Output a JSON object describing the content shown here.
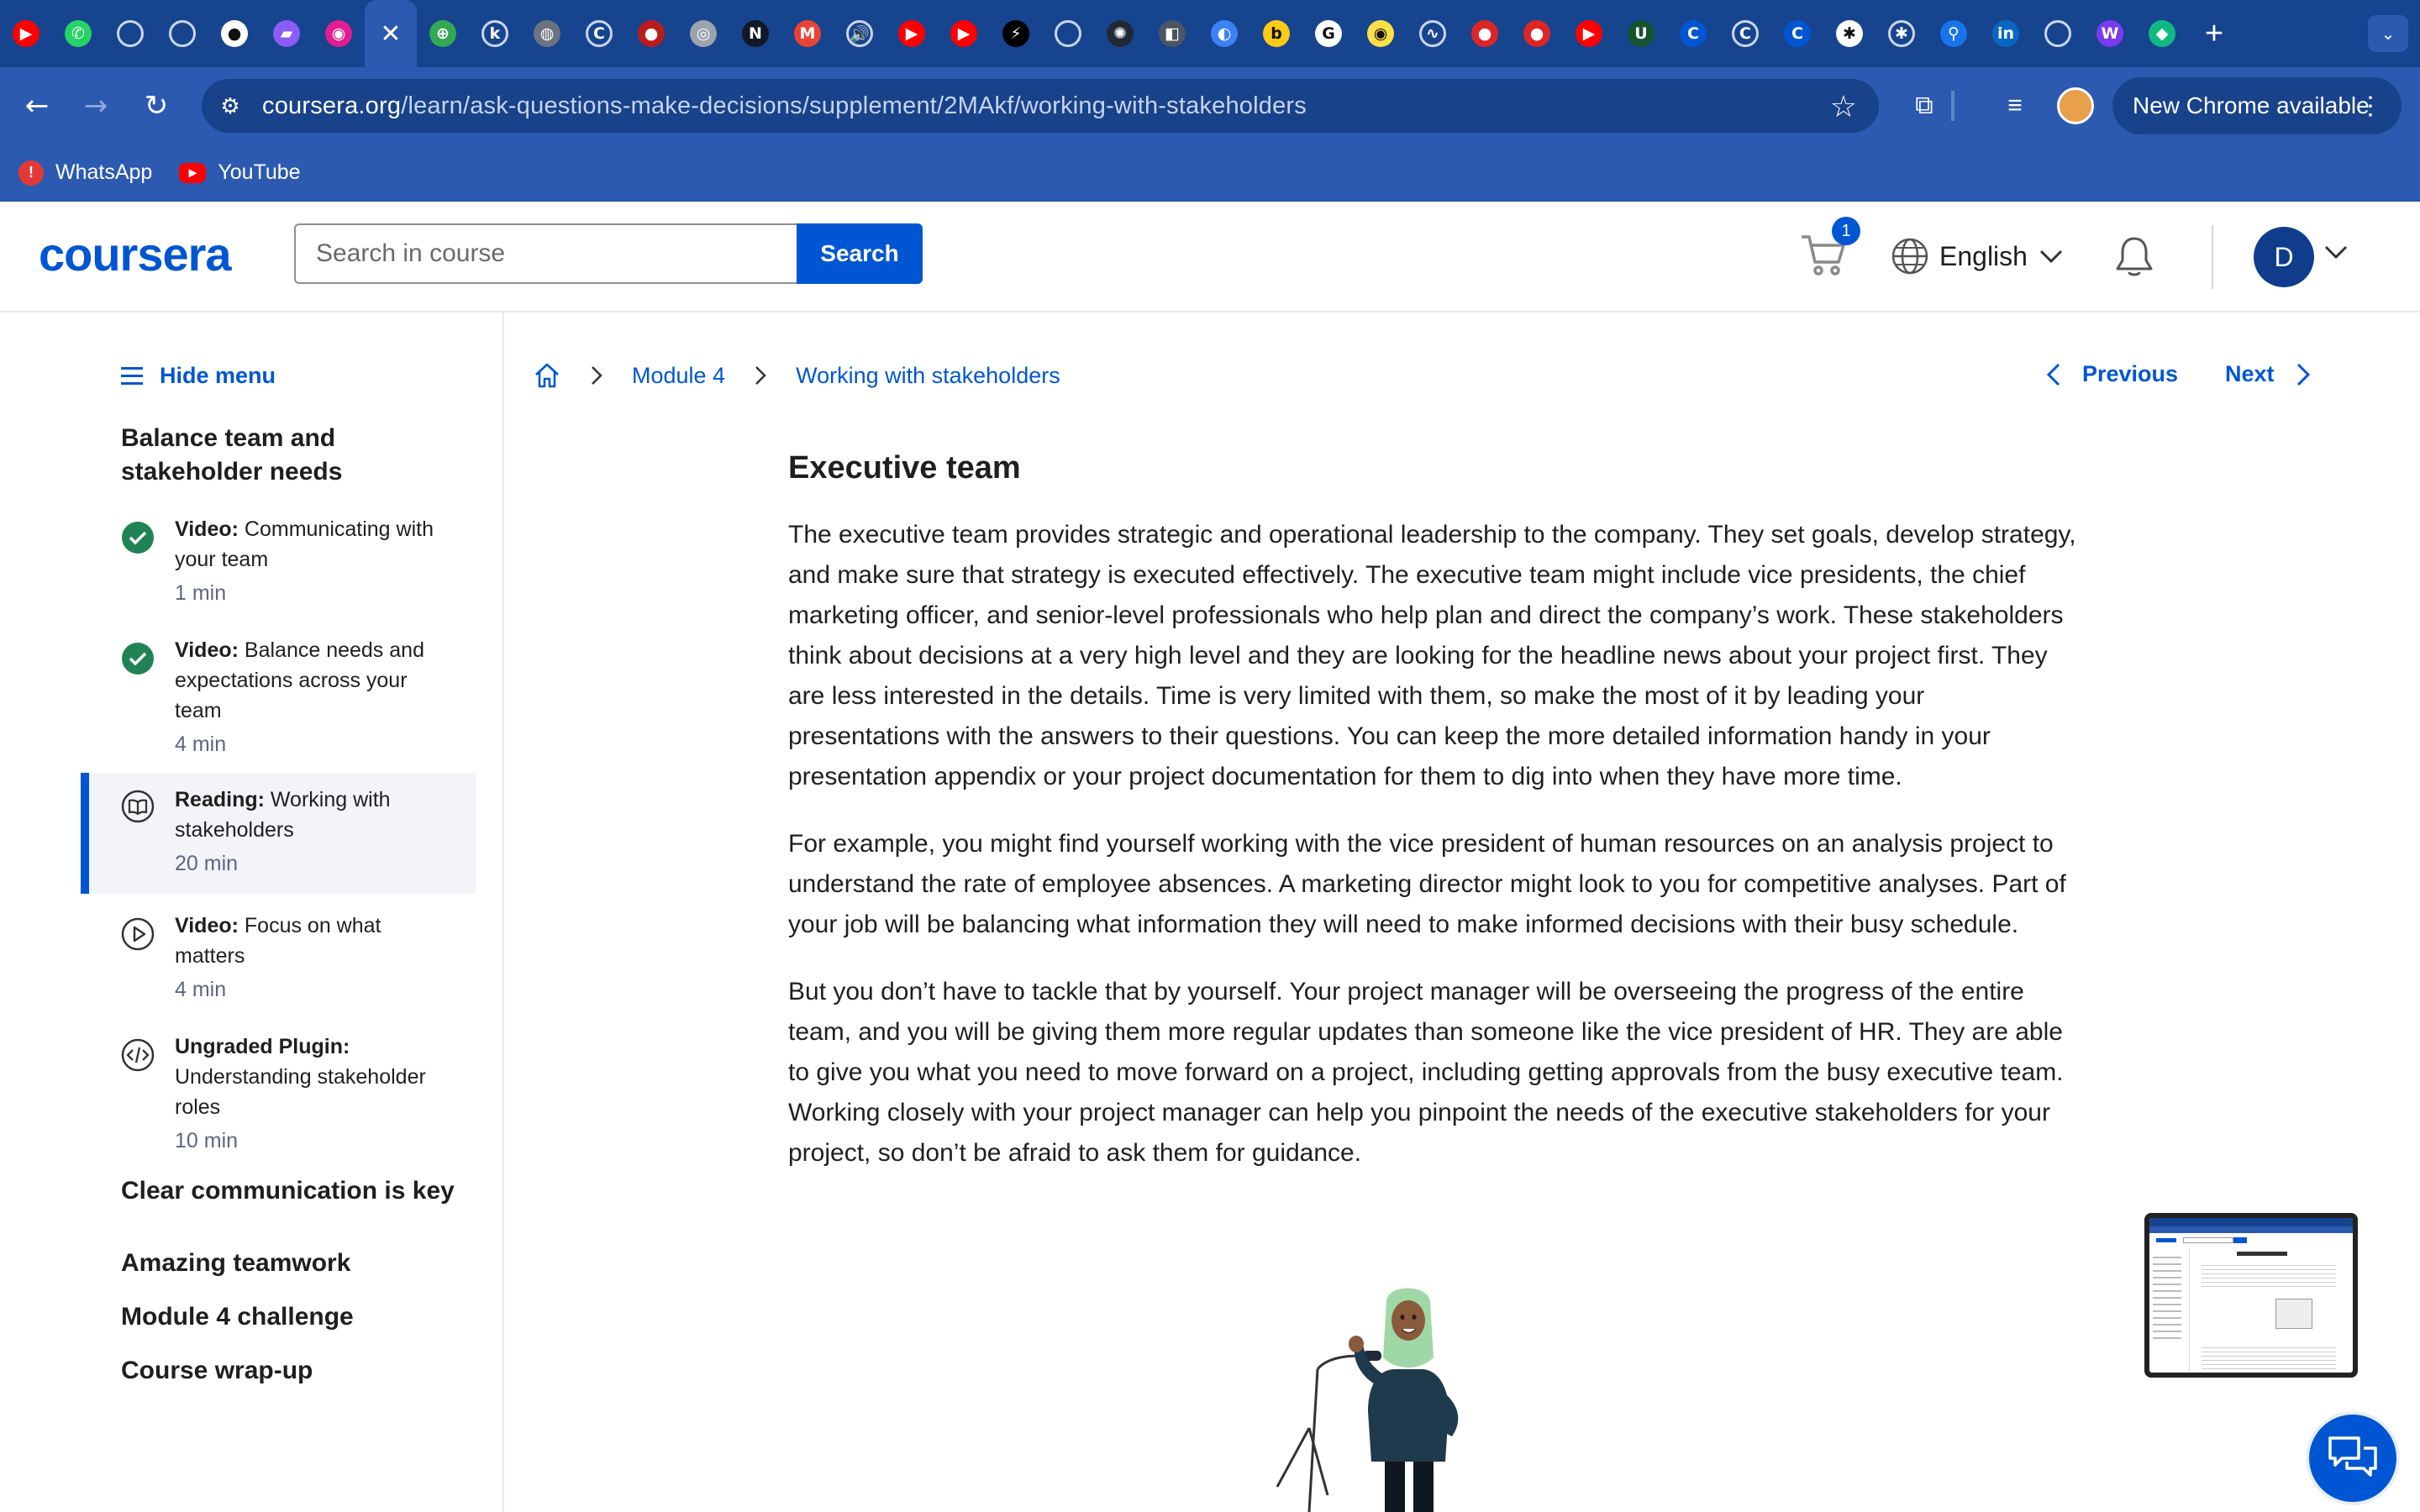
{
  "browser": {
    "tabs": [
      {
        "icon": "youtube-icon",
        "color": "#ff0000",
        "glyph": "▶"
      },
      {
        "icon": "whatsapp-icon",
        "color": "#25d366",
        "glyph": "✆"
      },
      {
        "icon": "loading-icon",
        "color": "",
        "glyph": ""
      },
      {
        "icon": "loading-icon",
        "color": "",
        "glyph": ""
      },
      {
        "icon": "github-icon",
        "color": "#ffffff",
        "glyph": "●"
      },
      {
        "icon": "app-icon",
        "color": "#8b5cf6",
        "glyph": "▰"
      },
      {
        "icon": "app-icon",
        "color": "#e11d8f",
        "glyph": "◉"
      },
      {
        "icon": "close-tab-icon",
        "active": true,
        "glyph": "✕"
      },
      {
        "icon": "app-icon",
        "color": "#34a853",
        "glyph": "⊕"
      },
      {
        "icon": "app-icon",
        "color": "",
        "glyph": "k"
      },
      {
        "icon": "globe-icon",
        "color": "#6b7280",
        "glyph": "◍"
      },
      {
        "icon": "coursera-icon",
        "color": "",
        "glyph": "C"
      },
      {
        "icon": "record-icon",
        "color": "#b91c1c",
        "glyph": "●"
      },
      {
        "icon": "app-icon",
        "color": "#9ca3af",
        "glyph": "◎"
      },
      {
        "icon": "app-icon",
        "color": "#111827",
        "glyph": "N"
      },
      {
        "icon": "gmail-icon",
        "color": "#ea4335",
        "glyph": "M"
      },
      {
        "icon": "speaker-icon",
        "color": "",
        "glyph": "🔊"
      },
      {
        "icon": "youtube-icon",
        "color": "#ff0000",
        "glyph": "▶"
      },
      {
        "icon": "youtube-icon",
        "color": "#ff0000",
        "glyph": "▶"
      },
      {
        "icon": "app-icon",
        "color": "#000000",
        "glyph": "⚡"
      },
      {
        "icon": "loading-icon",
        "color": "",
        "glyph": ""
      },
      {
        "icon": "app-icon",
        "color": "#1f2937",
        "glyph": "✺"
      },
      {
        "icon": "zoom-icon",
        "color": "#4b5563",
        "glyph": "◧"
      },
      {
        "icon": "app-icon",
        "color": "#3b82f6",
        "glyph": "◐"
      },
      {
        "icon": "app-icon",
        "color": "#facc15",
        "glyph": "b"
      },
      {
        "icon": "google-icon",
        "color": "#ffffff",
        "glyph": "G"
      },
      {
        "icon": "app-icon",
        "color": "#fde047",
        "glyph": "◉"
      },
      {
        "icon": "app-icon",
        "color": "",
        "glyph": "∿"
      },
      {
        "icon": "app-icon",
        "color": "#dc2626",
        "glyph": "●"
      },
      {
        "icon": "app-icon",
        "color": "#dc2626",
        "glyph": "●"
      },
      {
        "icon": "youtube-icon",
        "color": "#ff0000",
        "glyph": "▶"
      },
      {
        "icon": "app-icon",
        "color": "#14532d",
        "glyph": "U"
      },
      {
        "icon": "coursera-icon",
        "color": "#0056d2",
        "glyph": "C"
      },
      {
        "icon": "coursera-icon",
        "color": "",
        "glyph": "C"
      },
      {
        "icon": "coursera-icon",
        "color": "#0056d2",
        "glyph": "C"
      },
      {
        "icon": "openai-icon",
        "color": "#ffffff",
        "glyph": "✱"
      },
      {
        "icon": "openai-icon",
        "color": "",
        "glyph": "✱"
      },
      {
        "icon": "maps-icon",
        "color": "#1a73e8",
        "glyph": "⚲"
      },
      {
        "icon": "linkedin-icon",
        "color": "#0a66c2",
        "glyph": "in"
      },
      {
        "icon": "loading-icon",
        "color": "",
        "glyph": ""
      },
      {
        "icon": "app-icon",
        "color": "#7c3aed",
        "glyph": "W"
      },
      {
        "icon": "app-icon",
        "color": "#10b981",
        "glyph": "◆"
      }
    ],
    "new_tab_icon": "+",
    "url_host": "coursera.org",
    "url_path": "/learn/ask-questions-make-decisions/supplement/2MAkf/working-with-stakeholders",
    "update_label": "New Chrome available",
    "bookmarks": [
      {
        "label": "WhatsApp",
        "icon": "whatsapp-icon"
      },
      {
        "label": "YouTube",
        "icon": "youtube-icon"
      }
    ]
  },
  "header": {
    "logo": "coursera",
    "search_placeholder": "Search in course",
    "search_button": "Search",
    "cart_count": "1",
    "language": "English",
    "avatar_initial": "D"
  },
  "sidebar": {
    "hide_menu": "Hide menu",
    "section_title": "Balance team and stakeholder needs",
    "items": [
      {
        "type": "Video:",
        "title": "Communicating with your team",
        "duration": "1 min",
        "status": "completed"
      },
      {
        "type": "Video:",
        "title": "Balance needs and expectations across your team",
        "duration": "4 min",
        "status": "completed"
      },
      {
        "type": "Reading:",
        "title": "Working with stakeholders",
        "duration": "20 min",
        "status": "active"
      },
      {
        "type": "Video:",
        "title": "Focus on what matters",
        "duration": "4 min",
        "status": "todo"
      },
      {
        "type": "Ungraded Plugin:",
        "title": "Understanding stakeholder roles",
        "duration": "10 min",
        "status": "todo"
      }
    ],
    "other_sections": [
      "Clear communication is key",
      "Amazing teamwork",
      "Module 4 challenge",
      "Course wrap-up"
    ]
  },
  "breadcrumb": {
    "module": "Module 4",
    "page": "Working with stakeholders"
  },
  "pager": {
    "previous": "Previous",
    "next": "Next"
  },
  "article": {
    "heading": "Executive team",
    "paragraphs": [
      "The executive team provides strategic and operational leadership to the company. They set goals, develop strategy, and make sure that strategy is executed effectively. The executive team might include vice presidents, the chief marketing officer, and senior-level professionals who help plan and direct the company’s work. These stakeholders think about decisions at a very high level and they are looking for the headline news about your project first.  They are less interested in the details. Time is very limited with them, so make the most of it by leading your presentations with the answers to their questions. You can keep the more detailed information handy in your presentation appendix or your project documentation for them to dig into when they have more time.",
      "For example, you might find yourself working with the vice president of human resources on an analysis project to understand the rate of employee absences. A marketing director might look to you for competitive analyses. Part of your job will be balancing what information they will need to make informed decisions with their busy schedule.",
      "But you don’t have to tackle that by yourself. Your project manager will be overseeing the progress of the entire team, and you will be giving them more regular updates than someone like the vice president of HR. They are able to give you what you need to move forward on a project, including getting approvals from the busy executive team. Working closely with your project manager can help you pinpoint the needs of the executive stakeholders for your project, so don’t be afraid to ask them for guidance."
    ]
  },
  "colors": {
    "brand": "#0056d2",
    "chrome_dark": "#17448f",
    "chrome": "#2b5ab0",
    "complete": "#1f8354"
  }
}
